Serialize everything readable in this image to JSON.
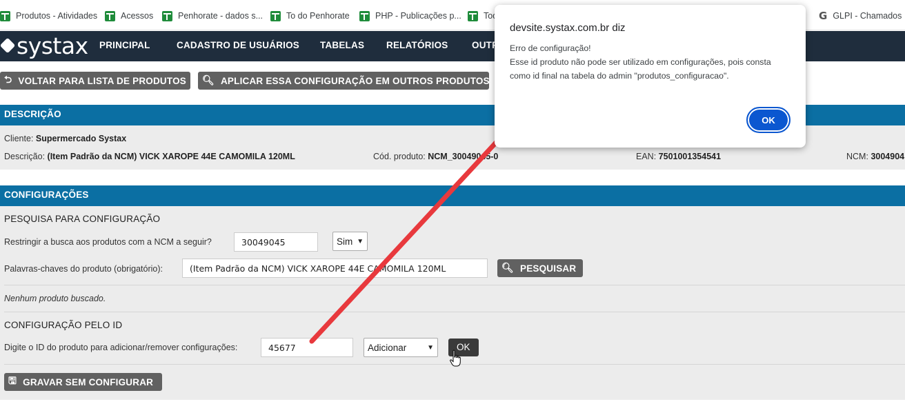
{
  "bookmarks": [
    {
      "label": "Produtos - Atividades",
      "icon": "sheet-icon"
    },
    {
      "label": "Acessos",
      "icon": "sheet-icon"
    },
    {
      "label": "Penhorate - dados s...",
      "icon": "sheet-icon"
    },
    {
      "label": "To do Penhorate",
      "icon": "sheet-icon"
    },
    {
      "label": "PHP - Publicações p...",
      "icon": "sheet-icon"
    },
    {
      "label": "Tod",
      "icon": "sheet-icon"
    },
    {
      "label": "GLPI - Chamados",
      "icon": "glpi-icon"
    }
  ],
  "brand": {
    "logo": "systax"
  },
  "nav": [
    "PRINCIPAL",
    "CADASTRO DE USUÁRIOS",
    "TABELAS",
    "RELATÓRIOS",
    "OUTR"
  ],
  "actions": {
    "back": "VOLTAR PARA LISTA DE PRODUTOS",
    "apply": "APLICAR ESSA CONFIGURAÇÃO EM OUTROS PRODUTOS"
  },
  "descricao": {
    "header": "DESCRIÇÃO",
    "cliente_label": "Cliente:",
    "cliente": "Supermercado Systax",
    "descricao_label": "Descrição:",
    "descricao": "(Item Padrão da NCM) VICK XAROPE 44E CAMOMILA 120ML",
    "cod_label": "Cód. produto:",
    "cod": "NCM_30049045-0",
    "ean_label": "EAN:",
    "ean": "7501001354541",
    "ncm_label": "NCM:",
    "ncm": "3004904"
  },
  "config": {
    "header": "CONFIGURAÇÕES",
    "search_title": "PESQUISA PARA CONFIGURAÇÃO",
    "restrict_label": "Restringir a busca aos produtos com a NCM a seguir?",
    "restrict_ncm": "30049045",
    "restrict_select": "Sim",
    "keywords_label": "Palavras-chaves do produto (obrigatório):",
    "keywords": "(Item Padrão da NCM) VICK XAROPE 44E CAMOMILA 120ML",
    "search_button": "PESQUISAR",
    "empty_msg": "Nenhum produto buscado.",
    "by_id_title": "CONFIGURAÇÃO PELO ID",
    "id_label": "Digite o ID do produto para adicionar/remover configurações:",
    "id_value": "45677",
    "action_select": "Adicionar",
    "ok_button": "OK",
    "save_button": "GRAVAR SEM CONFIGURAR"
  },
  "dialog": {
    "title": "devsite.systax.com.br diz",
    "line1": "Erro de configuração!",
    "line2": "Esse id produto não pode ser utilizado em configurações, pois consta",
    "line3": "como id final na tabela do admin \"produtos_configuracao\".",
    "ok": "OK"
  },
  "colors": {
    "accent": "#0b6fa3",
    "navbar": "#1f2d3d",
    "annotation_arrow": "#e8393d",
    "dialog_button": "#0b57d0"
  }
}
